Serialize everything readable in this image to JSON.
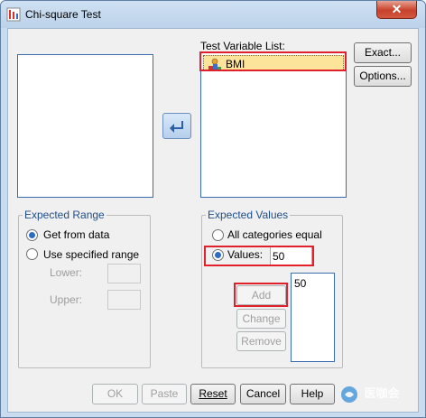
{
  "window": {
    "title": "Chi-square Test",
    "close_glyph": "✕"
  },
  "test_variable_list": {
    "label": "Test Variable List:",
    "items": [
      {
        "name": "BMI",
        "icon": "scale-variable-icon"
      }
    ]
  },
  "side_buttons": {
    "exact": "Exact...",
    "options": "Options..."
  },
  "expected_range": {
    "title": "Expected Range",
    "get_from_data": "Get from data",
    "use_specified_range": "Use specified range",
    "lower_label": "Lower:",
    "upper_label": "Upper:",
    "lower_value": "",
    "upper_value": "",
    "selected": "get_from_data"
  },
  "expected_values": {
    "title": "Expected Values",
    "all_categories_equal": "All categories equal",
    "values_label": "Values:",
    "values_input": "50",
    "list": [
      "50"
    ],
    "add": "Add",
    "change": "Change",
    "remove": "Remove",
    "selected": "values"
  },
  "footer_buttons": {
    "ok": "OK",
    "paste": "Paste",
    "reset": "Reset",
    "cancel": "Cancel",
    "help": "Help"
  },
  "watermark": "医咖会",
  "colors": {
    "accent": "#2c6dc4",
    "highlight": "#e0202a",
    "selection": "#fce49a"
  }
}
